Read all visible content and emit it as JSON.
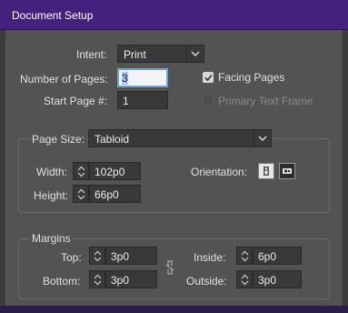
{
  "window": {
    "title": "Document Setup"
  },
  "intent": {
    "label": "Intent:",
    "value": "Print"
  },
  "pages": {
    "number_label": "Number of Pages:",
    "number_value": "3",
    "start_label": "Start Page #:",
    "start_value": "1"
  },
  "options": {
    "facing_pages_label": "Facing Pages",
    "facing_pages_checked": true,
    "primary_text_frame_label": "Primary Text Frame",
    "primary_text_frame_checked": false
  },
  "page_size": {
    "label": "Page Size:",
    "value": "Tabloid",
    "width_label": "Width:",
    "width_value": "102p0",
    "height_label": "Height:",
    "height_value": "66p0",
    "orientation_label": "Orientation:",
    "orientation_selected": "landscape"
  },
  "margins": {
    "legend": "Margins",
    "top_label": "Top:",
    "top_value": "3p0",
    "bottom_label": "Bottom:",
    "bottom_value": "3p0",
    "inside_label": "Inside:",
    "inside_value": "6p0",
    "outside_label": "Outside:",
    "outside_value": "3p0"
  },
  "colors": {
    "titlebar": "#44217c",
    "panel": "#535353",
    "field": "#393939",
    "focus_ring": "#6fa0e0"
  }
}
